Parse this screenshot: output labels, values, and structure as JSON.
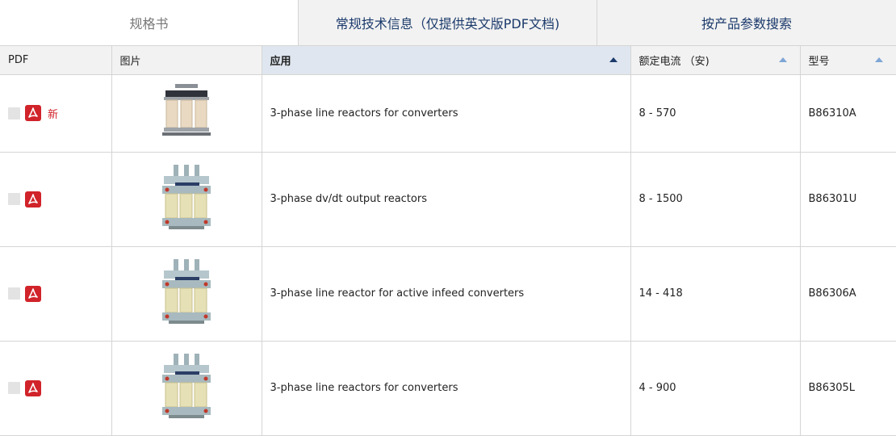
{
  "tabs": [
    {
      "label": "规格书",
      "active": true
    },
    {
      "label": "常规技术信息（仅提供英文版PDF文档)",
      "active": false
    },
    {
      "label": "按产品参数搜索",
      "active": false
    }
  ],
  "table": {
    "headers": {
      "pdf": "PDF",
      "image": "图片",
      "application": "应用",
      "current": "额定电流 （安)",
      "type": "型号"
    },
    "rows": [
      {
        "new_badge": "新",
        "application": "3-phase line reactors for converters",
        "current": "8 - 570",
        "type": "B86310A"
      },
      {
        "new_badge": "",
        "application": "3-phase dv/dt output reactors",
        "current": "8 - 1500",
        "type": "B86301U"
      },
      {
        "new_badge": "",
        "application": "3-phase line reactor for active infeed converters",
        "current": "14 - 418",
        "type": "B86306A"
      },
      {
        "new_badge": "",
        "application": "3-phase line reactors for converters",
        "current": "4 - 900",
        "type": "B86305L"
      }
    ]
  },
  "icons": {
    "pdf": "pdf-icon",
    "sort": "sort-arrow-up-icon"
  },
  "colors": {
    "accent_navy": "#1b3a6b",
    "pdf_red": "#d1232a",
    "sort_light": "#7fa6d6",
    "header_bg": "#f2f2f2",
    "sorted_header_bg": "#dfe6ef"
  }
}
